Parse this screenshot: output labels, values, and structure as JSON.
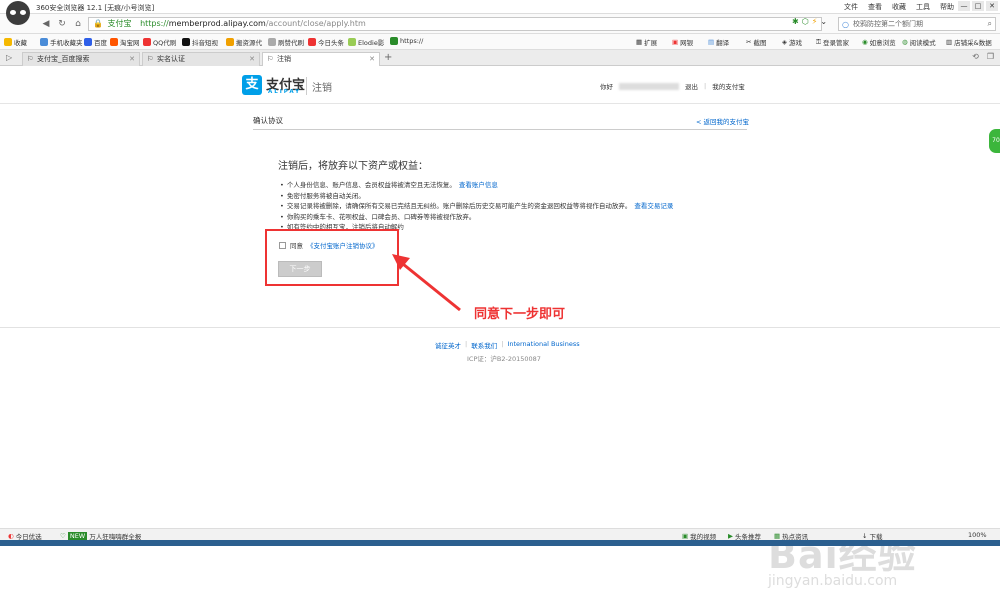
{
  "browser": {
    "title": "360安全浏览器 12.1 [无痕/小号浏览]",
    "menu": [
      "文件",
      "查看",
      "收藏",
      "工具",
      "帮助"
    ],
    "win_controls": [
      "—",
      "□",
      "✕"
    ]
  },
  "address": {
    "site_label": "支付宝",
    "scheme": "https://",
    "host": "memberprod.alipay.com",
    "path": "/account/close/apply.htm",
    "search_text": "校鸦防控第二个额门期"
  },
  "favorites": [
    {
      "label": "收藏",
      "color": "#f5b800"
    },
    {
      "label": "手机收藏夹",
      "color": "#4a8cd8"
    },
    {
      "label": "百度",
      "color": "#2e5fe8"
    },
    {
      "label": "淘宝网",
      "color": "#ff5500"
    },
    {
      "label": "QQ代刷",
      "color": "#e33"
    },
    {
      "label": "抖音短视",
      "color": "#111"
    },
    {
      "label": "搬资源代",
      "color": "#f0a000"
    },
    {
      "label": "刷赞代刷",
      "color": "#aaa"
    },
    {
      "label": "今日头条",
      "color": "#e33"
    },
    {
      "label": "Elodie影",
      "color": "#9c5"
    },
    {
      "label": "https://",
      "color": "#2a8c2a"
    }
  ],
  "fav_right": [
    "扩展",
    "网银",
    "翻译",
    "截图",
    "游戏",
    "登录管家",
    "如意浏览",
    "阅读模式",
    "店铺采&数据"
  ],
  "tabs": [
    {
      "label": "支付宝_百度搜索",
      "active": false
    },
    {
      "label": "实名认证",
      "active": false
    },
    {
      "label": "注销",
      "active": true
    }
  ],
  "page": {
    "logo_char": "支",
    "brand": "支付宝",
    "brand_en": "ALIPAY",
    "section": "注销",
    "greeting": "你好",
    "logout": "退出",
    "my_alipay": "我的支付宝",
    "confirm_title": "确认协议",
    "back_link": "< 返回我的支付宝",
    "heading": "注销后，将放弃以下资产或权益：",
    "notices": [
      {
        "text": "个人身份信息、账户信息、会员权益将被清空且无法恢复。",
        "link": "查看账户信息"
      },
      {
        "text": "免密付服务将被自动关闭。",
        "link": ""
      },
      {
        "text": "交易记录将被删除，请确保所有交易已完结且无纠纷。账户删除后历史交易可能产生的资金退回权益等将视作自动放弃。",
        "link": "查看交易记录"
      },
      {
        "text": "你购买的乘车卡、花呗权益、口碑会员、口碑券等将被视作放弃。",
        "link": ""
      },
      {
        "text": "如有签约中的相互宝，注销后将自动解约",
        "link": ""
      }
    ],
    "agree_label": "同意",
    "agree_link": "《支付宝账户注销协议》",
    "next_button": "下一步",
    "annotation": "同意下一步即可",
    "footer_links": [
      "诚征英才",
      "联系我们",
      "International Business"
    ],
    "icp": "ICP证：沪B2-20150087",
    "side_bubble": "70"
  },
  "watermark": {
    "brand": "Bai经验",
    "url": "jingyan.baidu.com"
  },
  "status": {
    "left": [
      "今日优选",
      "万人狂嗨嗨群全报"
    ],
    "right": [
      "我的视频",
      "头条推荐",
      "热点资讯",
      "下载",
      "100%"
    ]
  }
}
